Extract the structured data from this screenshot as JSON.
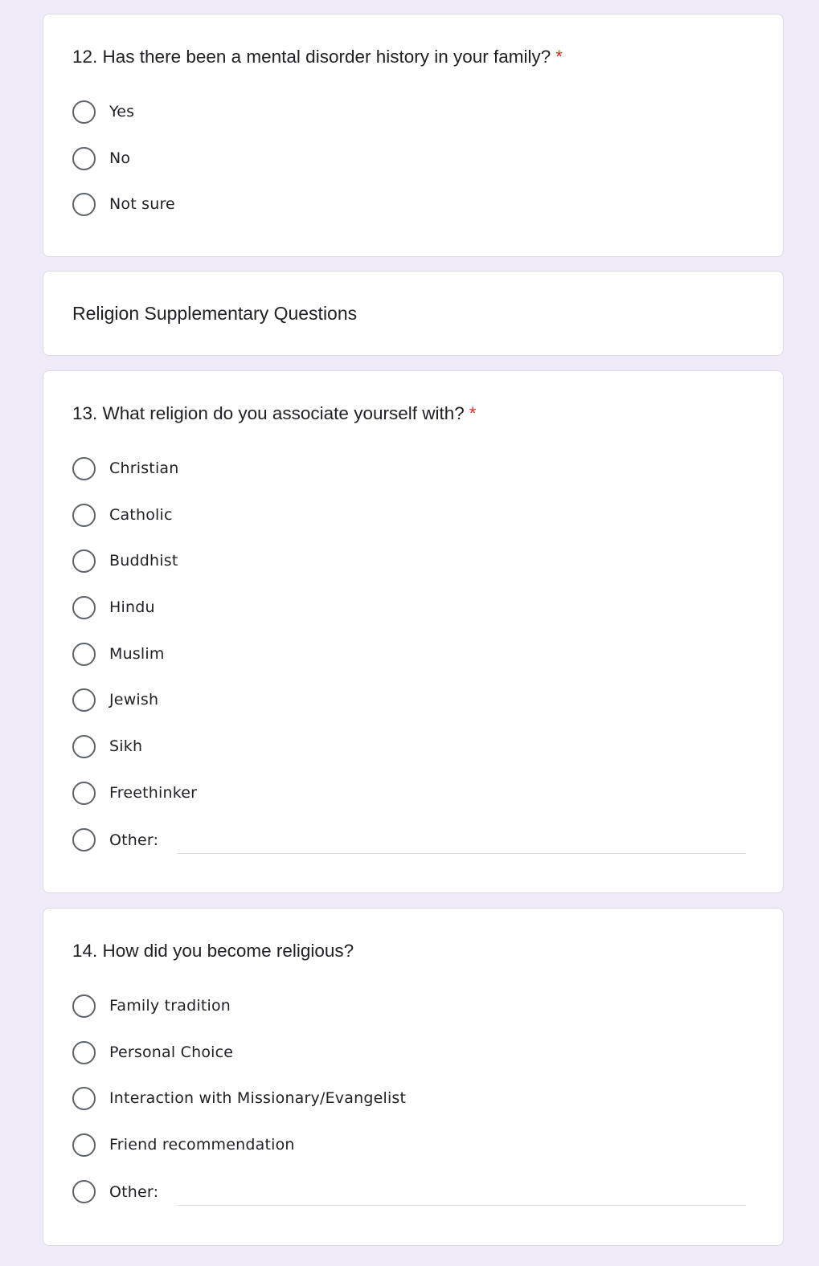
{
  "q12": {
    "title": "12. Has there been a mental disorder history in your family?",
    "required": "*",
    "options": [
      "Yes",
      "No",
      "Not sure"
    ]
  },
  "section": {
    "title": "Religion Supplementary Questions"
  },
  "q13": {
    "title": "13. What religion do you associate yourself with?",
    "required": "*",
    "options": [
      "Christian",
      "Catholic",
      "Buddhist",
      "Hindu",
      "Muslim",
      "Jewish",
      "Sikh",
      "Freethinker"
    ],
    "other_label": "Other:",
    "other_value": ""
  },
  "q14": {
    "title": "14. How did you become religious?",
    "options": [
      "Family tradition",
      "Personal Choice",
      "Interaction with Missionary/Evangelist",
      "Friend recommendation"
    ],
    "other_label": "Other:",
    "other_value": ""
  },
  "colors": {
    "page_background": "#efebf8",
    "card_background": "#ffffff",
    "required_star": "#d93025",
    "radio_border": "#5f6368"
  }
}
